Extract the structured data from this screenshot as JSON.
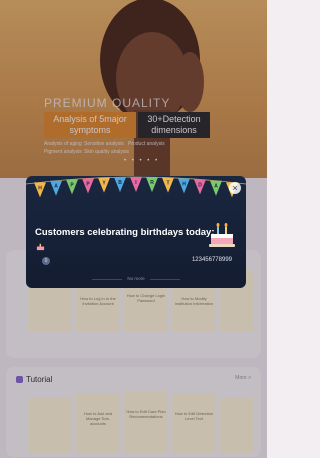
{
  "hero": {
    "premium_text": "PREMIUM QUALITY",
    "card_a": "Analysis of 5major symptoms",
    "card_b": "30+Detection dimensions",
    "mini_labels": [
      "Analysis of aging",
      "Sensitive analysis",
      "Product analysis",
      "Pigment analysis",
      "Skin quality analysis"
    ],
    "dots": "• • • • •"
  },
  "help_cards": [
    "How to Log in to the Invitation Account",
    "How to Change Login Password",
    "How to Modify Institution Information",
    "How to Add and Manage Sub-accounts",
    "How to Edit Care Plan Recommendations",
    "How to Edit Detection Level Text"
  ],
  "tutorial": {
    "title": "Tutorial",
    "more": "More >"
  },
  "birthday_dialog": {
    "banner_letters": [
      "H",
      "A",
      "P",
      "P",
      "Y",
      "B",
      "I",
      "R",
      "T",
      "H",
      "D",
      "A",
      "Y"
    ],
    "title": "Customers celebrating birthdays today:",
    "customer": {
      "avatar_text": "9",
      "id": "123456778999"
    },
    "footer": "No more",
    "close_label": "×"
  },
  "colors": {
    "dialog_bg": "#1a2740",
    "accent_orange": "#e08a2c",
    "hero_bg": "#d79a52"
  }
}
